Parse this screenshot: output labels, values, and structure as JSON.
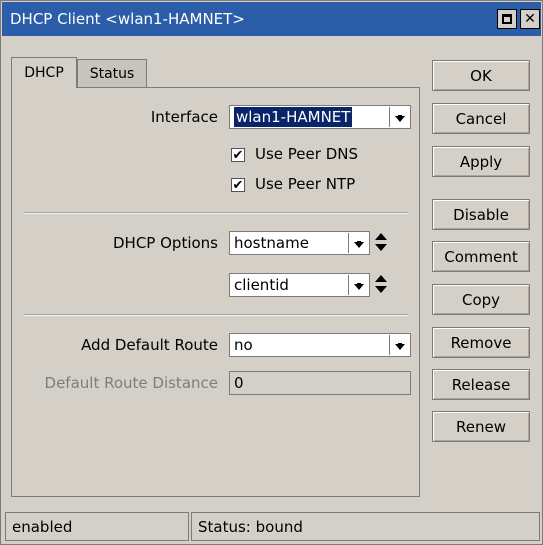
{
  "window": {
    "title": "DHCP Client <wlan1-HAMNET>"
  },
  "tabs": [
    {
      "label": "DHCP",
      "active": true
    },
    {
      "label": "Status",
      "active": false
    }
  ],
  "form": {
    "interface": {
      "label": "Interface",
      "value": "wlan1-HAMNET"
    },
    "use_peer_dns": {
      "label": "Use Peer DNS",
      "checked": true
    },
    "use_peer_ntp": {
      "label": "Use Peer NTP",
      "checked": true
    },
    "dhcp_options": {
      "label": "DHCP Options",
      "values": [
        "hostname",
        "clientid"
      ]
    },
    "add_default_route": {
      "label": "Add Default Route",
      "value": "no"
    },
    "default_route_distance": {
      "label": "Default Route Distance",
      "value": "0"
    }
  },
  "buttons": {
    "ok": "OK",
    "cancel": "Cancel",
    "apply": "Apply",
    "disable": "Disable",
    "comment": "Comment",
    "copy": "Copy",
    "remove": "Remove",
    "release": "Release",
    "renew": "Renew"
  },
  "status": {
    "left": "enabled",
    "right": "Status: bound"
  },
  "check_glyph": "✔",
  "colors": {
    "titlebar": "#2b5da9",
    "window_bg": "#d4d0c8",
    "selection": "#0a246a"
  },
  "icons": {
    "maximize": "maximize-icon",
    "close": "close-icon",
    "dropdown": "dropdown-arrow-icon",
    "updown": "up-down-arrows-icon",
    "checkmark": "checkmark-icon"
  }
}
